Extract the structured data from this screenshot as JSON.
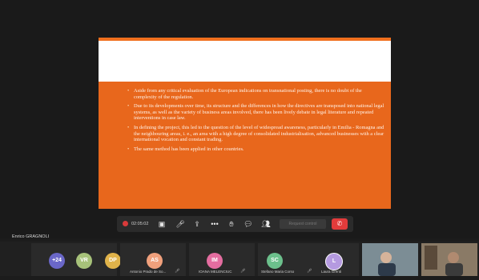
{
  "slide": {
    "bullets": [
      "Aside from any critical evaluation of the European indications on transnational posting, there is no doubt of the complexity of the regulation.",
      "Due to its developments over time, its structure and the differences in how the directives are transposed into national legal systems, as well as the variety of business areas involved, there has been lively debate in legal literature and repeated interventions in case law.",
      "In defining the project, this led to the question of the level of widespread awareness, particularly in Emilia - Romagna and the neighbouring areas, i. e., an area with a high degree of consolidated industrialisation, advanced businesses with a clear international vocation and constant trading.",
      "The same method has been applied in other countries."
    ]
  },
  "toolbar": {
    "record_time": "02:05:02",
    "request_control_label": "Request control",
    "icons": [
      "record-icon",
      "screen-share-icon",
      "mute-icon",
      "share-icon",
      "more-icon",
      "raise-hand-icon",
      "chat-icon",
      "participants-icon",
      "end-call-icon"
    ]
  },
  "presenter": {
    "name": "Enrico GRAGNOLI"
  },
  "participants": {
    "more_count": "+24",
    "avatars": [
      {
        "initials": "VR",
        "color": "#a7c27a"
      },
      {
        "initials": "DP",
        "color": "#e0b34a"
      },
      {
        "initials": "AS",
        "color": "#f0a07c",
        "name": "Antonio Prado de So..."
      },
      {
        "initials": "IM",
        "color": "#e46da0",
        "name": "IOANA MELENCIUC"
      },
      {
        "initials": "SC",
        "color": "#6cc08c",
        "name": "Stefano Maria Corso"
      },
      {
        "initials": "L",
        "color": "#b59ae0",
        "name": "Laura Grenti"
      }
    ],
    "video_tiles": [
      {
        "label": "participant-video-1"
      },
      {
        "label": "participant-video-2"
      }
    ]
  }
}
